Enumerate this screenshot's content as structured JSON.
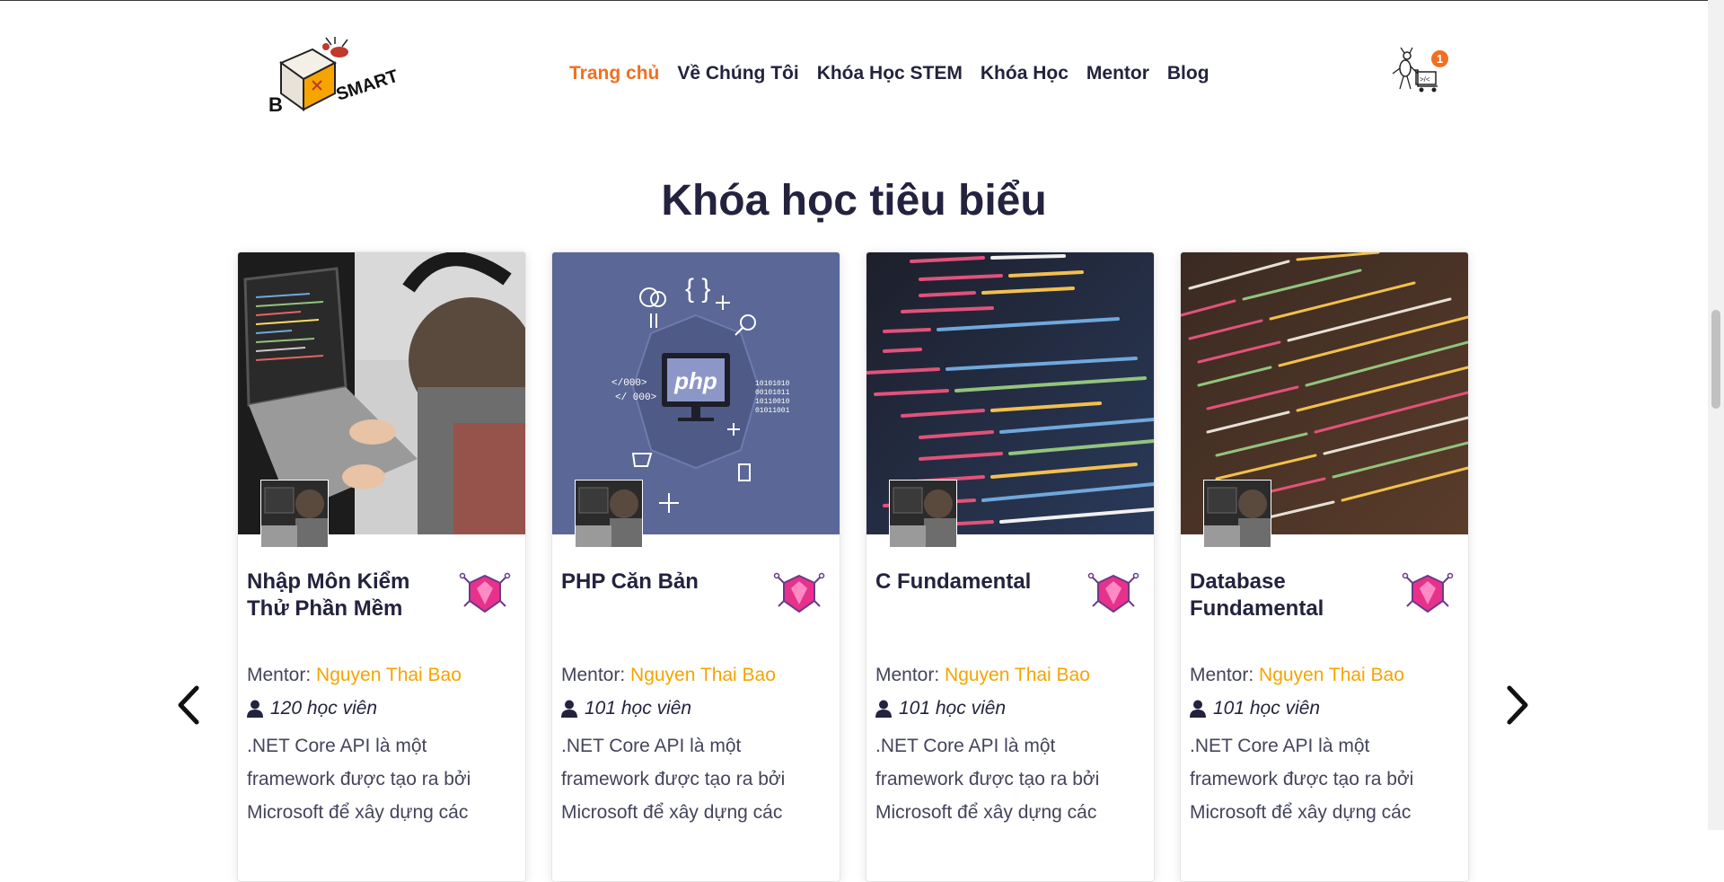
{
  "header": {
    "logo_text": "BSMART",
    "nav": [
      {
        "label": "Trang chủ",
        "active": true
      },
      {
        "label": "Về Chúng Tôi",
        "active": false
      },
      {
        "label": "Khóa Học STEM",
        "active": false
      },
      {
        "label": "Khóa Học",
        "active": false
      },
      {
        "label": "Mentor",
        "active": false
      },
      {
        "label": "Blog",
        "active": false
      }
    ],
    "cart_count": "1",
    "cart_icon": "ant-cart-icon"
  },
  "section": {
    "title": "Khóa học tiêu biểu",
    "prev_icon": "chevron-left-icon",
    "next_icon": "chevron-right-icon"
  },
  "courses": [
    {
      "title": "Nhập Môn Kiểm Thử Phần Mềm",
      "mentor_label": "Mentor: ",
      "mentor_name": "Nguyen Thai Bao",
      "students": "120 học viên",
      "description": ".NET Core API là một framework được tạo ra bởi Microsoft để xây dựng các",
      "image": "person-laptop"
    },
    {
      "title": "PHP Căn Bản",
      "mentor_label": "Mentor: ",
      "mentor_name": "Nguyen Thai Bao",
      "students": "101 học viên",
      "description": ".NET Core API là một framework được tạo ra bởi Microsoft để xây dựng các",
      "image": "php-illustration"
    },
    {
      "title": "C Fundamental",
      "mentor_label": "Mentor: ",
      "mentor_name": "Nguyen Thai Bao",
      "students": "101 học viên",
      "description": ".NET Core API là một framework được tạo ra bởi Microsoft để xây dựng các",
      "image": "code-dark-blue"
    },
    {
      "title": "Database Fundamental",
      "mentor_label": "Mentor: ",
      "mentor_name": "Nguyen Thai Bao",
      "students": "101 học viên",
      "description": ".NET Core API là một framework được tạo ra bởi Microsoft để xây dựng các",
      "image": "code-brown"
    }
  ],
  "colors": {
    "accent": "#f26f21",
    "mentor": "#f5a400",
    "text_dark": "#23233f",
    "badge_pink": "#e8318a"
  }
}
